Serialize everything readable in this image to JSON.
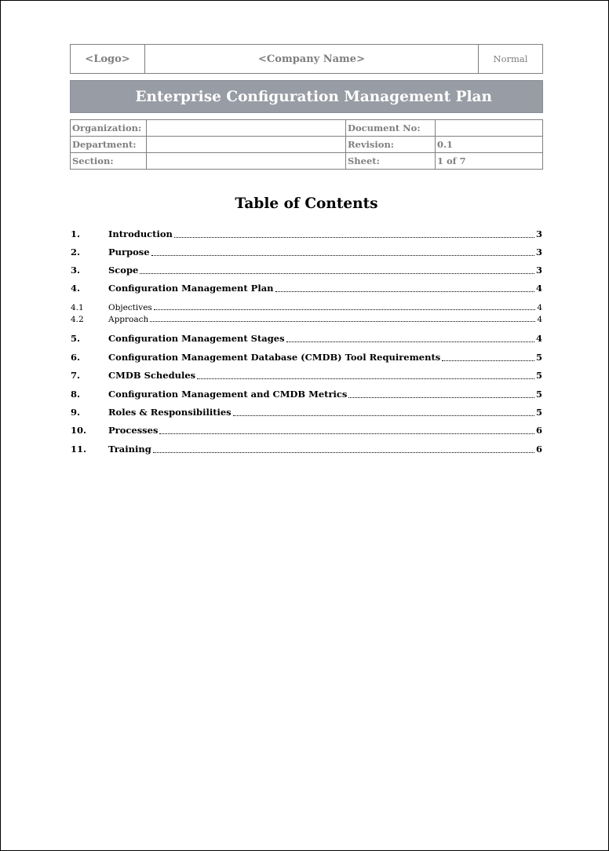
{
  "header": {
    "logo": "<Logo>",
    "company": "<Company Name>",
    "status": "Normal"
  },
  "title": "Enterprise Configuration Management Plan",
  "meta": {
    "rows": [
      {
        "label1": "Organization:",
        "value1": "",
        "label2": "Document No:",
        "value2": ""
      },
      {
        "label1": "Department:",
        "value1": "",
        "label2": "Revision:",
        "value2": "0.1"
      },
      {
        "label1": "Section:",
        "value1": "",
        "label2": "Sheet:",
        "value2": "1 of 7"
      }
    ]
  },
  "toc": {
    "title": "Table of Contents",
    "entries": [
      {
        "num": "1.",
        "label": "Introduction",
        "page": "3",
        "level": "main"
      },
      {
        "num": "2.",
        "label": "Purpose",
        "page": "3",
        "level": "main"
      },
      {
        "num": "3.",
        "label": "Scope",
        "page": "3",
        "level": "main"
      },
      {
        "num": "4.",
        "label": "Configuration Management Plan",
        "page": "4",
        "level": "main"
      },
      {
        "num": "4.1",
        "label": "Objectives",
        "page": "4",
        "level": "sub"
      },
      {
        "num": "4.2",
        "label": "Approach",
        "page": "4",
        "level": "sub"
      },
      {
        "num": "5.",
        "label": "Configuration Management Stages",
        "page": "4",
        "level": "main"
      },
      {
        "num": "6.",
        "label": "Configuration Management Database (CMDB) Tool Requirements",
        "page": "5",
        "level": "main"
      },
      {
        "num": "7.",
        "label": "CMDB Schedules",
        "page": "5",
        "level": "main"
      },
      {
        "num": "8.",
        "label": "Configuration Management and CMDB Metrics",
        "page": "5",
        "level": "main"
      },
      {
        "num": "9.",
        "label": "Roles & Responsibilities",
        "page": "5",
        "level": "main"
      },
      {
        "num": "10.",
        "label": "Processes",
        "page": "6",
        "level": "main"
      },
      {
        "num": "11.",
        "label": "Training",
        "page": "6",
        "level": "main"
      }
    ]
  }
}
